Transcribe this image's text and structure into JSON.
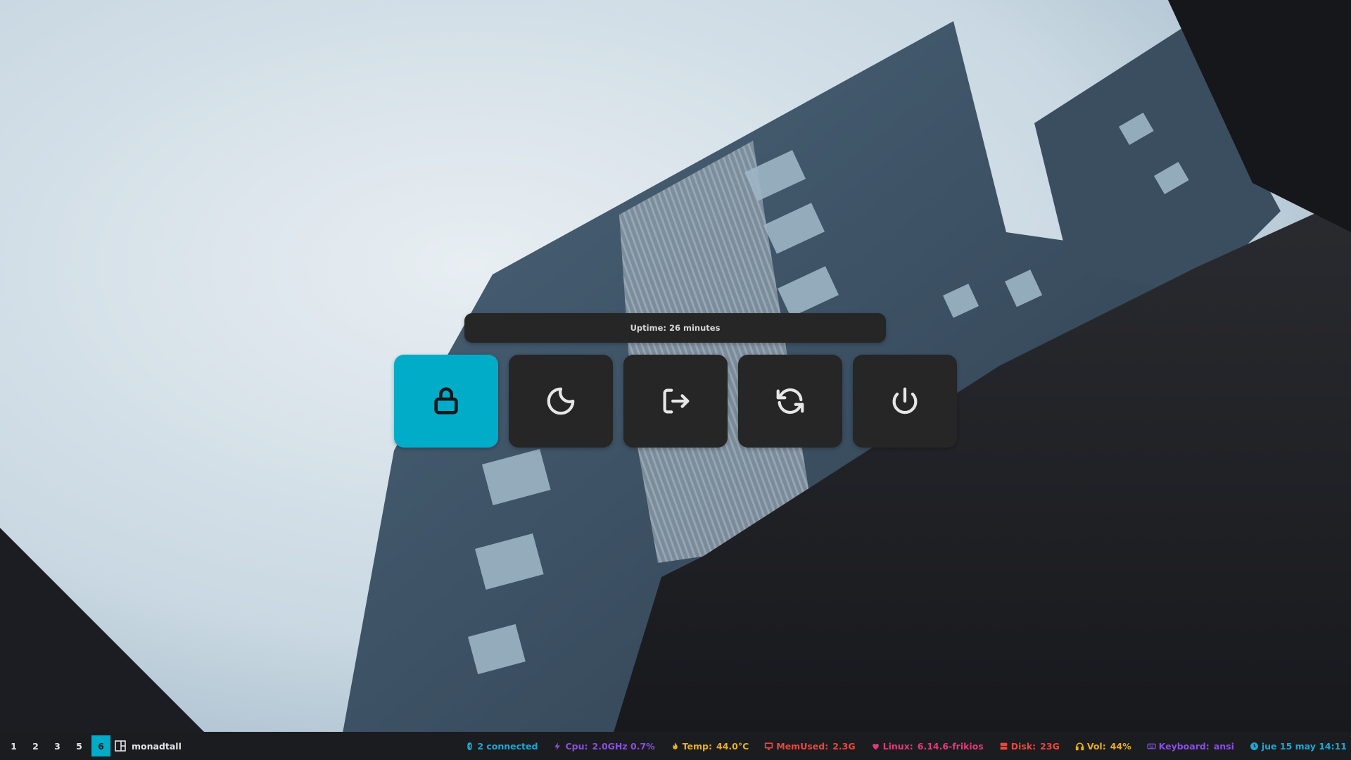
{
  "wallpaper": {
    "description_free": true,
    "sky_color": "#d4e0e8",
    "building_color": "#3e5468",
    "foreground_color": "#1c1d22"
  },
  "power_menu": {
    "uptime_text": "Uptime: 26 minutes",
    "accent_color": "#00acc8",
    "buttons": [
      {
        "id": "lock",
        "icon": "lock-icon",
        "active": true
      },
      {
        "id": "suspend",
        "icon": "moon-icon",
        "active": false
      },
      {
        "id": "logout",
        "icon": "logout-icon",
        "active": false
      },
      {
        "id": "reboot",
        "icon": "refresh-icon",
        "active": false
      },
      {
        "id": "shutdown",
        "icon": "power-icon",
        "active": false
      }
    ]
  },
  "bar": {
    "groups": [
      "1",
      "2",
      "3",
      "5",
      "6"
    ],
    "active_group": "6",
    "layout_icon": "layout-icon",
    "layout_name": "monadtall",
    "widgets": {
      "bluetooth": {
        "icon": "bluetooth-icon",
        "text": "2 connected",
        "color": "#1aa8d4"
      },
      "cpu": {
        "icon": "bolt-icon",
        "label": "Cpu:",
        "value": "2.0GHz 0.7%",
        "color": "#8a4fe0"
      },
      "temp": {
        "icon": "fire-icon",
        "label": "Temp:",
        "value": "44.0°C",
        "color": "#e8b020"
      },
      "memory": {
        "icon": "monitor-icon",
        "label": "MemUsed:",
        "value": "2.3G",
        "color": "#e8483c"
      },
      "kernel": {
        "icon": "heart-icon",
        "label": "Linux:",
        "value": "6.14.6-frikios",
        "color": "#e03a7a"
      },
      "disk": {
        "icon": "disk-icon",
        "label": "Disk:",
        "value": "23G",
        "color": "#e8483c"
      },
      "volume": {
        "icon": "headphones-icon",
        "label": "Vol:",
        "value": "44%",
        "color": "#e8b020"
      },
      "keyboard": {
        "icon": "keyboard-icon",
        "label": "Keyboard:",
        "value": "ansi",
        "color": "#8a4fe0"
      },
      "clock": {
        "icon": "clock-icon",
        "text": "jue 15 may 14:11",
        "color": "#1aa8d4"
      }
    }
  }
}
